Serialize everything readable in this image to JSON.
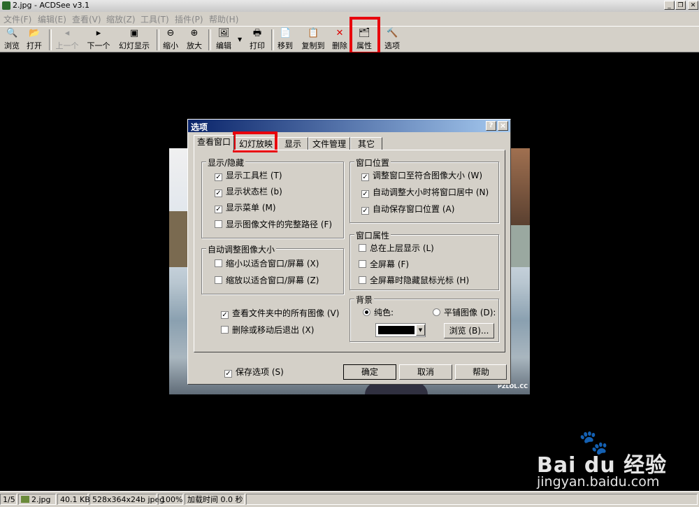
{
  "window": {
    "title": "2.jpg - ACDSee v3.1"
  },
  "menu": [
    "文件(F)",
    "编辑(E)",
    "查看(V)",
    "缩放(Z)",
    "工具(T)",
    "插件(P)",
    "帮助(H)"
  ],
  "toolbar": {
    "browse": "浏览",
    "open": "打开",
    "prev": "上一个",
    "next": "下一个",
    "slideshow": "幻灯显示",
    "zoom_out": "缩小",
    "zoom_in": "放大",
    "edit": "编辑",
    "print": "打印",
    "move_to": "移到",
    "copy_to": "复制到",
    "delete": "删除",
    "properties": "属性",
    "options": "选项"
  },
  "dialog": {
    "title": "选项",
    "help_btn": "?",
    "close_btn": "×",
    "tabs": [
      "查看窗口",
      "幻灯放映",
      "显示",
      "文件管理",
      "其它"
    ],
    "show_hide": {
      "title": "显示/隐藏",
      "items": [
        {
          "label": "显示工具栏 (T)",
          "checked": true
        },
        {
          "label": "显示状态栏 (b)",
          "checked": true
        },
        {
          "label": "显示菜单 (M)",
          "checked": true
        },
        {
          "label": "显示图像文件的完整路径 (F)",
          "checked": false
        }
      ]
    },
    "auto_resize": {
      "title": "自动调整图像大小",
      "items": [
        {
          "label": "缩小以适合窗口/屏幕 (X)",
          "checked": false
        },
        {
          "label": "缩放以适合窗口/屏幕 (Z)",
          "checked": false
        }
      ]
    },
    "misc": [
      {
        "label": "查看文件夹中的所有图像 (V)",
        "checked": true
      },
      {
        "label": "删除或移动后退出 (X)",
        "checked": false
      }
    ],
    "window_position": {
      "title": "窗口位置",
      "items": [
        {
          "label": "调整窗口至符合图像大小 (W)",
          "checked": true
        },
        {
          "label": "自动调整大小时将窗口居中 (N)",
          "checked": true
        },
        {
          "label": "自动保存窗口位置 (A)",
          "checked": true
        }
      ]
    },
    "window_props": {
      "title": "窗口属性",
      "items": [
        {
          "label": "总在上层显示 (L)",
          "checked": false
        },
        {
          "label": "全屏幕 (F)",
          "checked": false
        },
        {
          "label": "全屏幕时隐藏鼠标光标 (H)",
          "checked": false
        }
      ]
    },
    "background": {
      "title": "背景",
      "solid": "纯色:",
      "tile": "平铺图像 (D):",
      "color": "#000000",
      "browse": "浏览 (B)..."
    },
    "save_options": "保存选项 (S)",
    "ok": "确定",
    "cancel": "取消",
    "help": "帮助"
  },
  "status": {
    "index": "1/5",
    "file": "2.jpg",
    "size": "40.1 KB",
    "dims": "528x364x24b jpeg",
    "zoom": "100%",
    "load_time": "加载时间 0.0 秒"
  },
  "watermark": {
    "logo": "Bai du 经验",
    "url": "jingyan.baidu.com"
  },
  "image_text": "PZLOL.CC"
}
